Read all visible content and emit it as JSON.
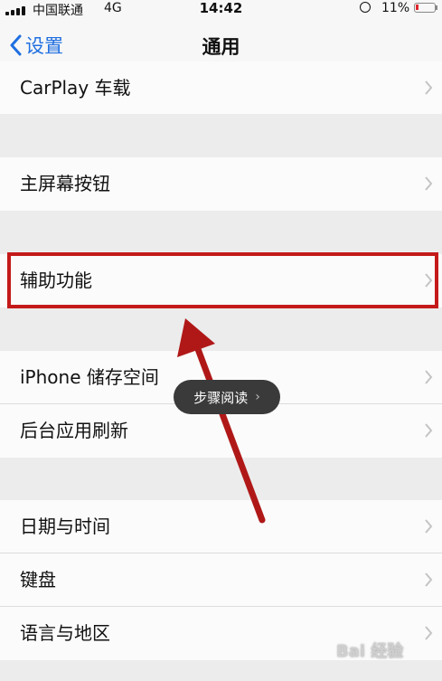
{
  "status_bar": {
    "carrier": "中国联通",
    "network": "4G",
    "time": "14:42",
    "battery_percent": "11%",
    "battery_color": "#e0262b"
  },
  "nav": {
    "back_label": "设置",
    "title": "通用",
    "accent_color": "#1f6fe0"
  },
  "groups": [
    {
      "items": [
        "CarPlay 车载"
      ]
    },
    {
      "items": [
        "主屏幕按钮"
      ]
    },
    {
      "items": [
        "辅助功能"
      ]
    },
    {
      "items": [
        "iPhone 储存空间",
        "后台应用刷新"
      ]
    },
    {
      "items": [
        "日期与时间",
        "键盘",
        "语言与地区"
      ]
    }
  ],
  "highlighted_item": "辅助功能",
  "annotation_color": "#c41a1a",
  "toast": {
    "label": "步骤阅读"
  },
  "watermark": {
    "text": "Bai 经验"
  }
}
